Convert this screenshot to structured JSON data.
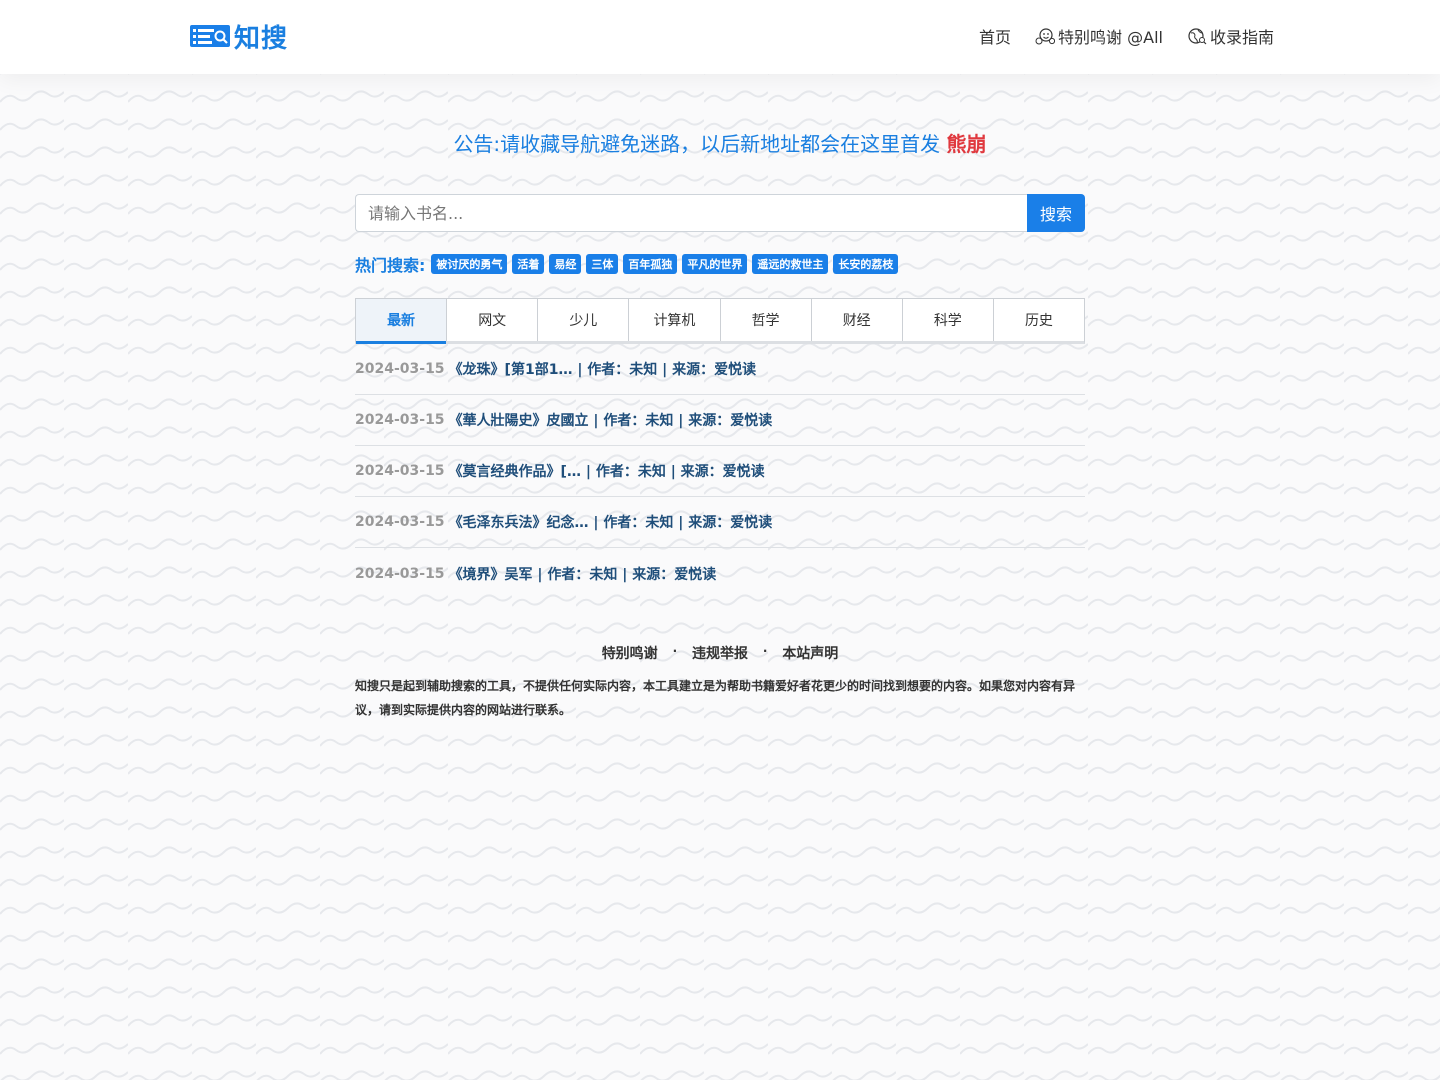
{
  "header": {
    "logo_text": "知搜",
    "nav": [
      {
        "label": "首页",
        "icon": null
      },
      {
        "label": "特别鸣谢 @All",
        "icon": "smile-group-icon"
      },
      {
        "label": "收录指南",
        "icon": "earth-icon"
      }
    ]
  },
  "announce": {
    "text": "公告:请收藏导航避免迷路，以后新地址都会在这里首发",
    "highlight": "熊崩"
  },
  "search": {
    "placeholder": "请输入书名...",
    "button_label": "搜索"
  },
  "hot": {
    "label": "热门搜索:",
    "tags": [
      "被讨厌的勇气",
      "活着",
      "易经",
      "三体",
      "百年孤独",
      "平凡的世界",
      "遥远的救世主",
      "长安的荔枝"
    ]
  },
  "tabs": {
    "items": [
      "最新",
      "网文",
      "少儿",
      "计算机",
      "哲学",
      "财经",
      "科学",
      "历史"
    ],
    "active": "最新"
  },
  "list": [
    {
      "date": "2024-03-15",
      "title": "《龙珠》[第1部1… | 作者：未知 | 来源：爱悦读"
    },
    {
      "date": "2024-03-15",
      "title": "《華人壯陽史》皮國立 | 作者：未知 | 来源：爱悦读"
    },
    {
      "date": "2024-03-15",
      "title": "《莫言经典作品》[… | 作者：未知 | 来源：爱悦读"
    },
    {
      "date": "2024-03-15",
      "title": "《毛泽东兵法》纪念… | 作者：未知 | 来源：爱悦读"
    },
    {
      "date": "2024-03-15",
      "title": "《境界》吴军 | 作者：未知 | 来源：爱悦读"
    }
  ],
  "footer": {
    "links": [
      "特别鸣谢",
      "违规举报",
      "本站声明"
    ],
    "separator": "·",
    "disclaimer": "知搜只是起到辅助搜索的工具，不提供任何实际内容，本工具建立是为帮助书籍爱好者花更少的时间找到想要的内容。如果您对内容有异议，请到实际提供内容的网站进行联系。"
  },
  "colors": {
    "accent": "#1a7fe8",
    "highlight": "#e0383e",
    "list_title": "#1f4e7a",
    "date": "#999999"
  }
}
